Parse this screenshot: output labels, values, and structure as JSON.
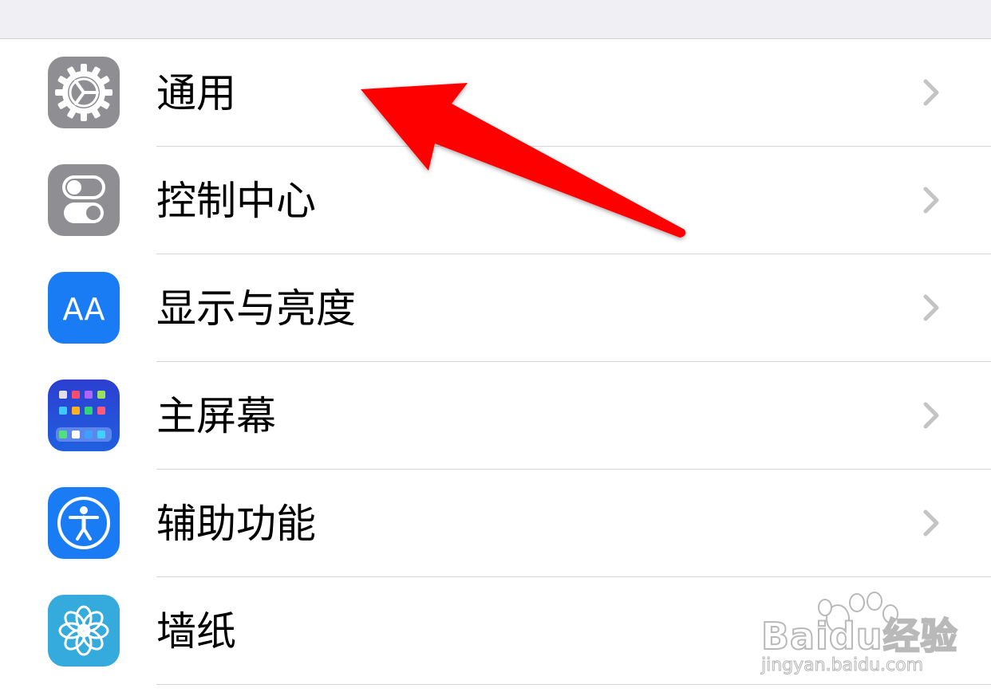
{
  "settings": {
    "items": [
      {
        "label": "通用",
        "icon": "gear-icon",
        "icon_bg": "#8e8e93"
      },
      {
        "label": "控制中心",
        "icon": "toggles-icon",
        "icon_bg": "#8e8e93"
      },
      {
        "label": "显示与亮度",
        "icon": "text-size-icon",
        "icon_bg": "#1a7cf5",
        "icon_text": "AA"
      },
      {
        "label": "主屏幕",
        "icon": "home-screen-grid-icon",
        "icon_bg": "#2744c9"
      },
      {
        "label": "辅助功能",
        "icon": "accessibility-icon",
        "icon_bg": "#1a7cf5"
      },
      {
        "label": "墙纸",
        "icon": "flower-icon",
        "icon_bg": "#35aadc"
      }
    ]
  },
  "annotation": {
    "color": "#ff0000",
    "icon": "red-arrow-icon"
  },
  "watermark": {
    "brand": "Baidu经验",
    "url": "jingyan.baidu.com"
  }
}
